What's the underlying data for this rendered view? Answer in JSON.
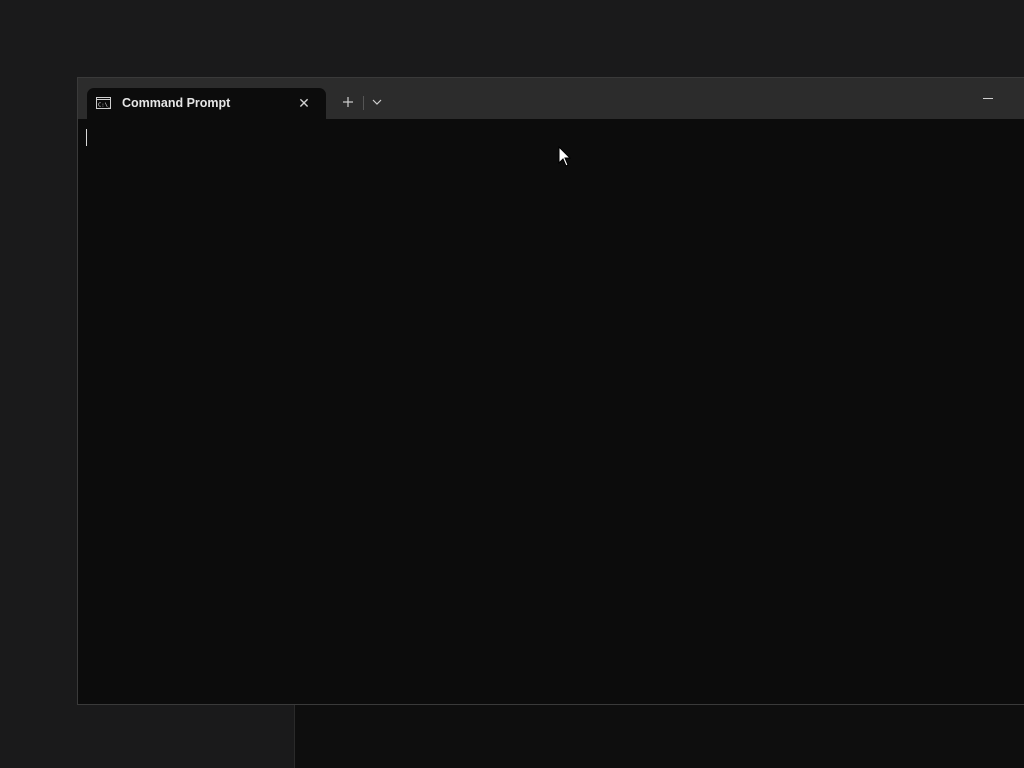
{
  "window": {
    "tabs": [
      {
        "title": "Command Prompt",
        "icon": "command-prompt-icon",
        "active": true
      }
    ],
    "new_tab_icon": "plus-icon",
    "dropdown_icon": "chevron-down-icon",
    "minimize_icon": "minimize-icon"
  },
  "console": {
    "output": ""
  },
  "colors": {
    "desktop": "#1a1a1b",
    "titlebar": "#2c2c2c",
    "console_bg": "#0c0c0c",
    "text": "#e6e6e6"
  }
}
